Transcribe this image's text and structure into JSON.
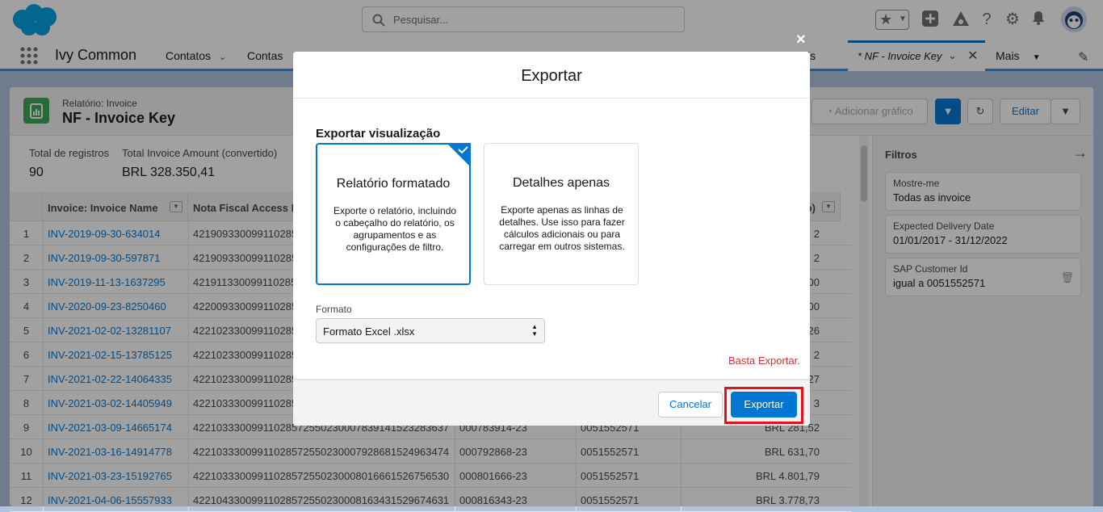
{
  "search": {
    "placeholder": "Pesquisar..."
  },
  "nav": {
    "app_name": "Ivy Common",
    "items": [
      "Contatos",
      "Contas"
    ],
    "partial_item": "ls",
    "active_tab": "* NF - Invoice Key",
    "more": "Mais"
  },
  "report": {
    "type_label": "Relatório: Invoice",
    "title": "NF - Invoice Key",
    "add_chart": "Adicionar gráfico",
    "edit": "Editar"
  },
  "summary": {
    "total_label": "Total de registros",
    "total_value": "90",
    "amount_label": "Total Invoice Amount (convertido)",
    "amount_value": "BRL 328.350,41"
  },
  "table": {
    "headers": [
      "Invoice: Invoice Name",
      "Nota Fiscal Access Key",
      "o)"
    ],
    "rows": [
      {
        "n": "1",
        "name": "INV-2019-09-30-634014",
        "key": "42190933009911028572",
        "doc": "",
        "cust": "",
        "amt": "2"
      },
      {
        "n": "2",
        "name": "INV-2019-09-30-597871",
        "key": "42190933009911028572",
        "doc": "",
        "cust": "",
        "amt": "2"
      },
      {
        "n": "3",
        "name": "INV-2019-11-13-1637295",
        "key": "42191133009911028572",
        "doc": "",
        "cust": "",
        "amt": "00"
      },
      {
        "n": "4",
        "name": "INV-2020-09-23-8250460",
        "key": "42200933009911028572",
        "doc": "",
        "cust": "",
        "amt": "00"
      },
      {
        "n": "5",
        "name": "INV-2021-02-02-13281107",
        "key": "42210233009911028572",
        "doc": "",
        "cust": "",
        "amt": "26"
      },
      {
        "n": "6",
        "name": "INV-2021-02-15-13785125",
        "key": "42210233009911028572",
        "doc": "",
        "cust": "",
        "amt": "2"
      },
      {
        "n": "7",
        "name": "INV-2021-02-22-14064335",
        "key": "42210233009911028572",
        "doc": "",
        "cust": "",
        "amt": "27"
      },
      {
        "n": "8",
        "name": "INV-2021-03-02-14405949",
        "key": "42210333009911028572",
        "doc": "",
        "cust": "",
        "amt": "3"
      },
      {
        "n": "9",
        "name": "INV-2021-03-09-14665174",
        "key": "42210333009911028572550230007839141523283637",
        "doc": "000783914-23",
        "cust": "0051552571",
        "amt": "BRL 281,52"
      },
      {
        "n": "10",
        "name": "INV-2021-03-16-14914778",
        "key": "42210333009911028572550230007928681524963474",
        "doc": "000792868-23",
        "cust": "0051552571",
        "amt": "BRL 631,70"
      },
      {
        "n": "11",
        "name": "INV-2021-03-23-15192765",
        "key": "42210333009911028572550230008016661526756530",
        "doc": "000801666-23",
        "cust": "0051552571",
        "amt": "BRL 4.801,79"
      },
      {
        "n": "12",
        "name": "INV-2021-04-06-15557933",
        "key": "42210433009911028572550230008163431529674631",
        "doc": "000816343-23",
        "cust": "0051552571",
        "amt": "BRL 3.778,73"
      }
    ]
  },
  "filters": {
    "title": "Filtros",
    "cards": [
      {
        "label": "Mostre-me",
        "value": "Todas as invoice"
      },
      {
        "label": "Expected Delivery Date",
        "value": "01/01/2017 - 31/12/2022"
      },
      {
        "label": "SAP Customer Id",
        "value": "igual a 0051552571"
      }
    ]
  },
  "modal": {
    "title": "Exportar",
    "section": "Exportar visualização",
    "options": [
      {
        "title": "Relatório formatado",
        "desc": "Exporte o relatório, incluindo o cabeçalho do relatório, os agrupamentos e as configurações de filtro."
      },
      {
        "title": "Detalhes apenas",
        "desc": "Exporte apenas as linhas de detalhes. Use isso para fazer cálculos adicionais ou para carregar em outros sistemas."
      }
    ],
    "format_label": "Formato",
    "format_value": "Formato Excel .xlsx",
    "note": "Basta Exportar.",
    "cancel": "Cancelar",
    "export": "Exportar",
    "close": "×"
  },
  "colors": {
    "brand": "#0176d3",
    "highlight": "#e3101d",
    "note": "#c23934"
  }
}
